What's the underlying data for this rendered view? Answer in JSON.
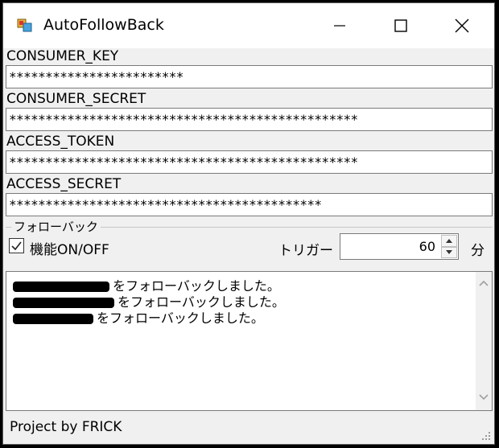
{
  "window": {
    "title": "AutoFollowBack"
  },
  "credentials": {
    "consumer_key_label": "CONSUMER_KEY",
    "consumer_key_value": "************************",
    "consumer_secret_label": "CONSUMER_SECRET",
    "consumer_secret_value": "************************************************",
    "access_token_label": "ACCESS_TOKEN",
    "access_token_value": "************************************************",
    "access_secret_label": "ACCESS_SECRET",
    "access_secret_value": "*******************************************"
  },
  "followback": {
    "group_title": "フォローバック",
    "enable_label": "機能ON/OFF",
    "enabled": true,
    "trigger_label": "トリガー",
    "trigger_value": "60",
    "unit": "分"
  },
  "log": {
    "lines": [
      "をフォローバックしました。",
      "をフォローバックしました。",
      "をフォローバックしました。"
    ]
  },
  "status": {
    "text": "Project by FRICK"
  },
  "icons": [
    "app-icon",
    "minimize-icon",
    "maximize-icon",
    "close-icon",
    "checkmark-icon",
    "spin-up-icon",
    "spin-down-icon",
    "scroll-up-icon",
    "scroll-down-icon",
    "resize-grip-icon"
  ]
}
